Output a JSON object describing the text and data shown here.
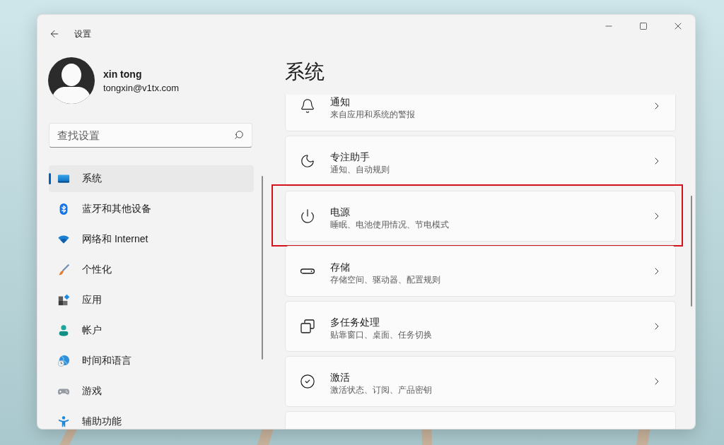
{
  "window": {
    "title": "设置"
  },
  "account": {
    "name": "xin tong",
    "email": "tongxin@v1tx.com"
  },
  "search": {
    "placeholder": "查找设置"
  },
  "sidebar": {
    "items": [
      {
        "kind": "system",
        "label": "系统",
        "selected": true
      },
      {
        "kind": "bluetooth",
        "label": "蓝牙和其他设备",
        "selected": false
      },
      {
        "kind": "network",
        "label": "网络和 Internet",
        "selected": false
      },
      {
        "kind": "personalization",
        "label": "个性化",
        "selected": false
      },
      {
        "kind": "apps",
        "label": "应用",
        "selected": false
      },
      {
        "kind": "accounts",
        "label": "帐户",
        "selected": false
      },
      {
        "kind": "time",
        "label": "时间和语言",
        "selected": false
      },
      {
        "kind": "gaming",
        "label": "游戏",
        "selected": false
      },
      {
        "kind": "accessibility",
        "label": "辅助功能",
        "selected": false
      }
    ]
  },
  "page": {
    "title": "系统",
    "cards": [
      {
        "kind": "notifications",
        "title": "通知",
        "subtitle": "来自应用和系统的警报",
        "highlighted": false
      },
      {
        "kind": "focus",
        "title": "专注助手",
        "subtitle": "通知、自动规则",
        "highlighted": false
      },
      {
        "kind": "power",
        "title": "电源",
        "subtitle": "睡眠、电池使用情况、节电模式",
        "highlighted": true
      },
      {
        "kind": "storage",
        "title": "存储",
        "subtitle": "存储空间、驱动器、配置规则",
        "highlighted": false
      },
      {
        "kind": "multitasking",
        "title": "多任务处理",
        "subtitle": "贴靠窗口、桌面、任务切换",
        "highlighted": false
      },
      {
        "kind": "activation",
        "title": "激活",
        "subtitle": "激活状态、订阅、产品密钥",
        "highlighted": false
      },
      {
        "kind": "partial"
      }
    ]
  }
}
